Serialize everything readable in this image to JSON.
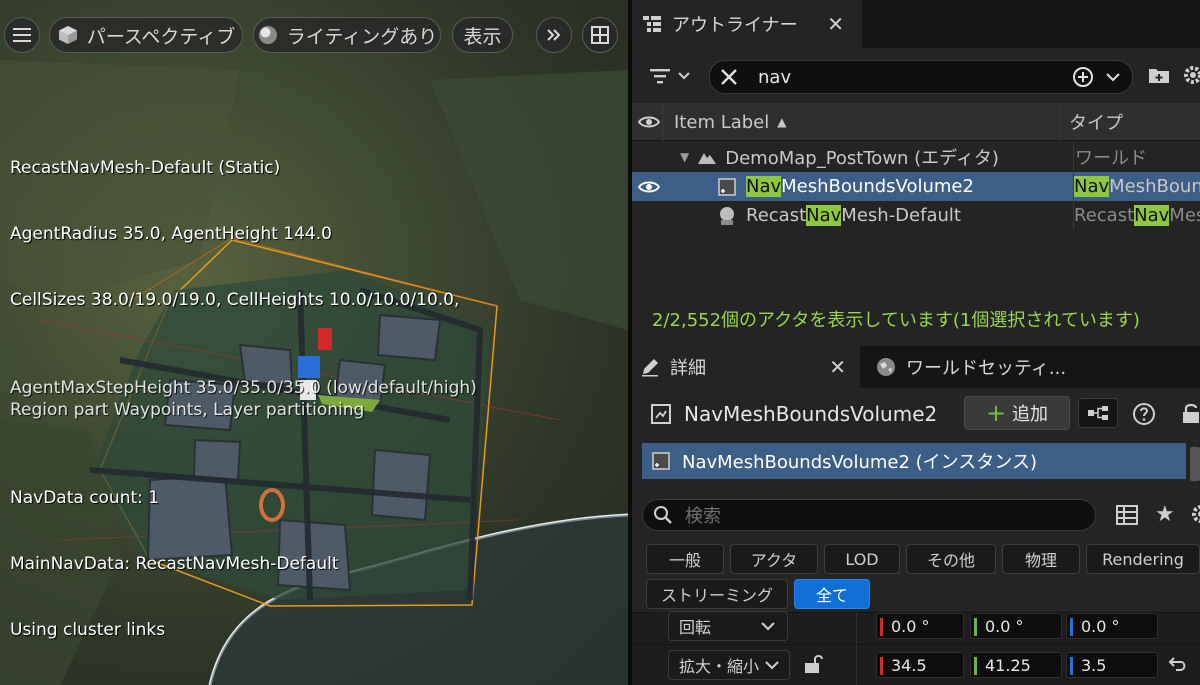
{
  "viewport": {
    "toolbar": {
      "perspective_label": "パースペクティブ",
      "lighting_label": "ライティングあり",
      "show_label": "表示"
    },
    "debug": {
      "line1": "RecastNavMesh-Default (Static)",
      "line2": "AgentRadius 35.0, AgentHeight 144.0",
      "line3": "CellSizes 38.0/19.0/19.0, CellHeights 10.0/10.0/10.0,",
      "line4a": "AgentMaxStepHeight 35.0/35.0/35.0 (low/default/high)",
      "line4b": "Region part Waypoints, Layer partitioning",
      "line5": "NavData count: 1",
      "line6": "MainNavData: RecastNavMesh-Default",
      "line7": "Using cluster links"
    }
  },
  "outliner": {
    "tab_label": "アウトライナー",
    "search_value": "nav",
    "col_label": "Item Label",
    "col_type": "タイプ",
    "rows": [
      {
        "label": "DemoMap_PostTown (エディタ)",
        "type": "ワールド"
      },
      {
        "label_hl": "Nav",
        "label_rest": "MeshBoundsVolume2",
        "type_hl": "Nav",
        "type_rest": "MeshBounds"
      },
      {
        "label_pre": "Recast",
        "label_hl": "Nav",
        "label_rest": "Mesh-Default",
        "type_pre": "Recast",
        "type_hl": "Nav",
        "type_rest": "Mesh"
      }
    ],
    "status": "2/2,552個のアクタを表示しています(1個選択されています)"
  },
  "details": {
    "tab_label": "詳細",
    "tab2_label": "ワールドセッティ...",
    "actor_name": "NavMeshBoundsVolume2",
    "add_label": "追加",
    "instance_label": "NavMeshBoundsVolume2 (インスタンス)",
    "search_placeholder": "検索",
    "filters": [
      "一般",
      "アクタ",
      "LOD",
      "その他",
      "物理",
      "Rendering",
      "ストリーミング",
      "全て"
    ],
    "rotation": {
      "label": "回転",
      "x": "0.0 °",
      "y": "0.0 °",
      "z": "0.0 °"
    },
    "scale": {
      "label": "拡大・縮小",
      "x": "34.5",
      "y": "41.25",
      "z": "3.5"
    }
  },
  "colors": {
    "accent": "#0f6fd6",
    "selection": "#3d5e86",
    "search_highlight": "#8dc63f",
    "status_green": "#9ad54b",
    "axis_x": "#d02a2a",
    "axis_y": "#6cb33f",
    "axis_z": "#2a6fd6"
  }
}
